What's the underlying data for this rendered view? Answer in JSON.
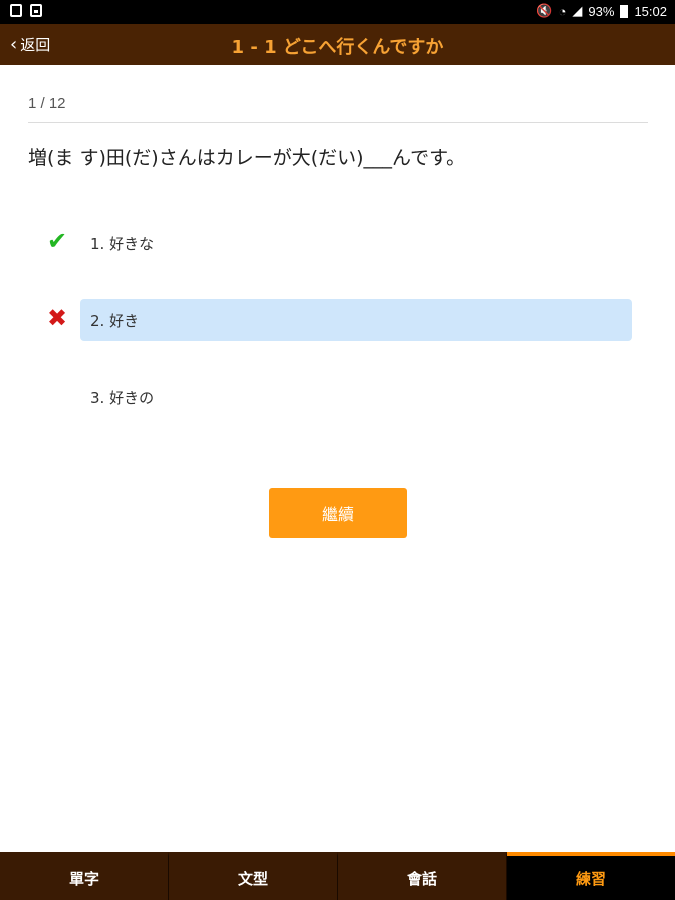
{
  "status_bar": {
    "battery": "93%",
    "time": "15:02"
  },
  "header": {
    "back_label": "返回",
    "title": "1 - 1 どこへ行くんですか"
  },
  "quiz": {
    "progress": "1 / 12",
    "question": "増(ま す)田(だ)さんはカレーが大(だい)___んです。",
    "options": [
      {
        "label": "1. 好きな",
        "state": "correct"
      },
      {
        "label": "2. 好き",
        "state": "wrong-selected"
      },
      {
        "label": "3. 好きの",
        "state": "none"
      }
    ],
    "continue_label": "繼續"
  },
  "bottom_nav": {
    "items": [
      {
        "label": "單字"
      },
      {
        "label": "文型"
      },
      {
        "label": "會話"
      },
      {
        "label": "練習"
      }
    ],
    "active_index": 3
  },
  "colors": {
    "header_bg": "#4a2304",
    "title": "#f7a234",
    "accent": "#ff9a12",
    "selected_bg": "#cfe6fb",
    "correct": "#23b623",
    "wrong": "#d31919"
  },
  "icons": [
    "back-chevron-icon",
    "check-icon",
    "cross-icon",
    "battery-icon"
  ]
}
